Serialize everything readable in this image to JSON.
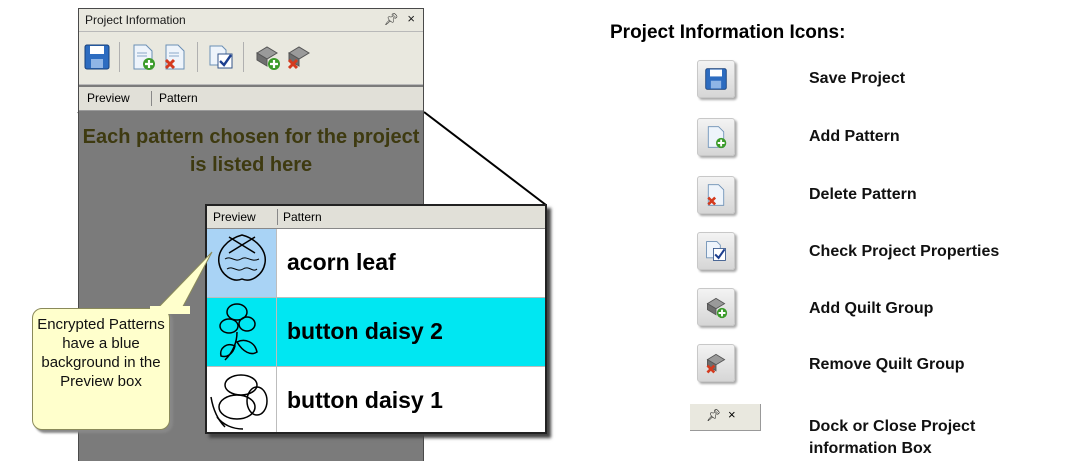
{
  "panel": {
    "title": "Project Information",
    "pin_glyph": "▂",
    "close_glyph": "×",
    "toolbar_icons": [
      "save-icon",
      "add-pattern-icon",
      "delete-pattern-icon",
      "check-properties-icon",
      "add-quilt-group-icon",
      "remove-quilt-group-icon"
    ],
    "tabs": [
      "Preview",
      "Pattern"
    ],
    "note": "Each pattern chosen for the project is listed here"
  },
  "zoom_table": {
    "columns": [
      "Preview",
      "Pattern"
    ],
    "rows": [
      {
        "name": "acorn leaf",
        "row_bg": "#ffffff",
        "preview_bg": "#a9d3f5"
      },
      {
        "name": "button daisy 2",
        "row_bg": "#00e7f2",
        "preview_bg": "#00e7f2"
      },
      {
        "name": "button daisy 1",
        "row_bg": "#ffffff",
        "preview_bg": "#ffffff"
      }
    ]
  },
  "callout": {
    "text": "Encrypted Patterns have a blue background in the Preview box"
  },
  "legend": {
    "title": "Project Information Icons:",
    "items": [
      {
        "icon": "save-icon",
        "label": "Save Project"
      },
      {
        "icon": "add-pattern-icon",
        "label": "Add Pattern"
      },
      {
        "icon": "delete-pattern-icon",
        "label": "Delete Pattern"
      },
      {
        "icon": "check-properties-icon",
        "label": "Check Project Properties"
      },
      {
        "icon": "add-quilt-group-icon",
        "label": "Add Quilt Group"
      },
      {
        "icon": "remove-quilt-group-icon",
        "label": "Remove Quilt Group"
      },
      {
        "icon": "dock-close-icon",
        "label": "Dock or Close Project information Box"
      }
    ]
  },
  "colors": {
    "panel_bg": "#7b7b7b",
    "note_text": "#3e3a10",
    "encrypted_preview": "#a9d3f5",
    "selected_row": "#00e7f2"
  }
}
